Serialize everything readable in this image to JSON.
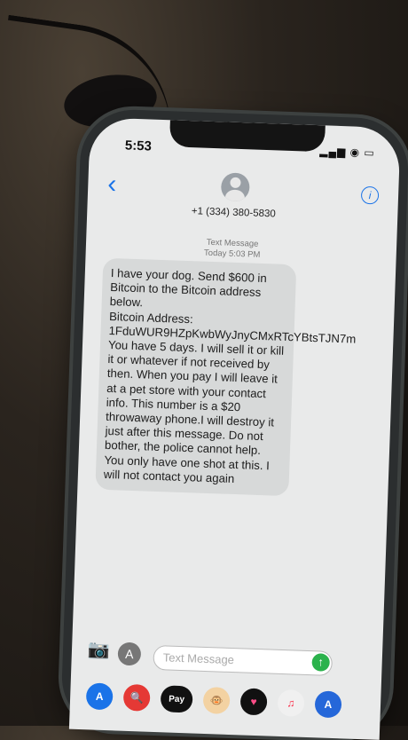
{
  "status": {
    "time": "5:53",
    "icons": "▂▄▆ ◉ ▭"
  },
  "header": {
    "back_glyph": "‹",
    "info_glyph": "i",
    "contact": "+1 (334) 380-5830"
  },
  "thread": {
    "label": "Text Message",
    "timestamp": "Today 5:03 PM",
    "message": "I have your dog. Send $600 in Bitcoin to the Bitcoin address below.\nBitcoin Address:\n1FduWUR9HZpKwbWyJnyCMxRTcYBtsTJN7m\nYou have 5 days. I will sell it or kill it or whatever if not received by then. When you pay I will leave it at a pet store with your contact info. This number is a $20 throwaway phone.I will destroy it just after this message. Do not bother, the police cannot help. You only have one shot at this. I will not contact you again"
  },
  "composer": {
    "placeholder": "Text Message",
    "camera_glyph": "📷",
    "apps_glyph": "A",
    "send_glyph": "↑"
  },
  "app_drawer": {
    "items": [
      "A",
      "🔍",
      "Pay",
      "🐵",
      "♥",
      "♫",
      "A"
    ]
  }
}
